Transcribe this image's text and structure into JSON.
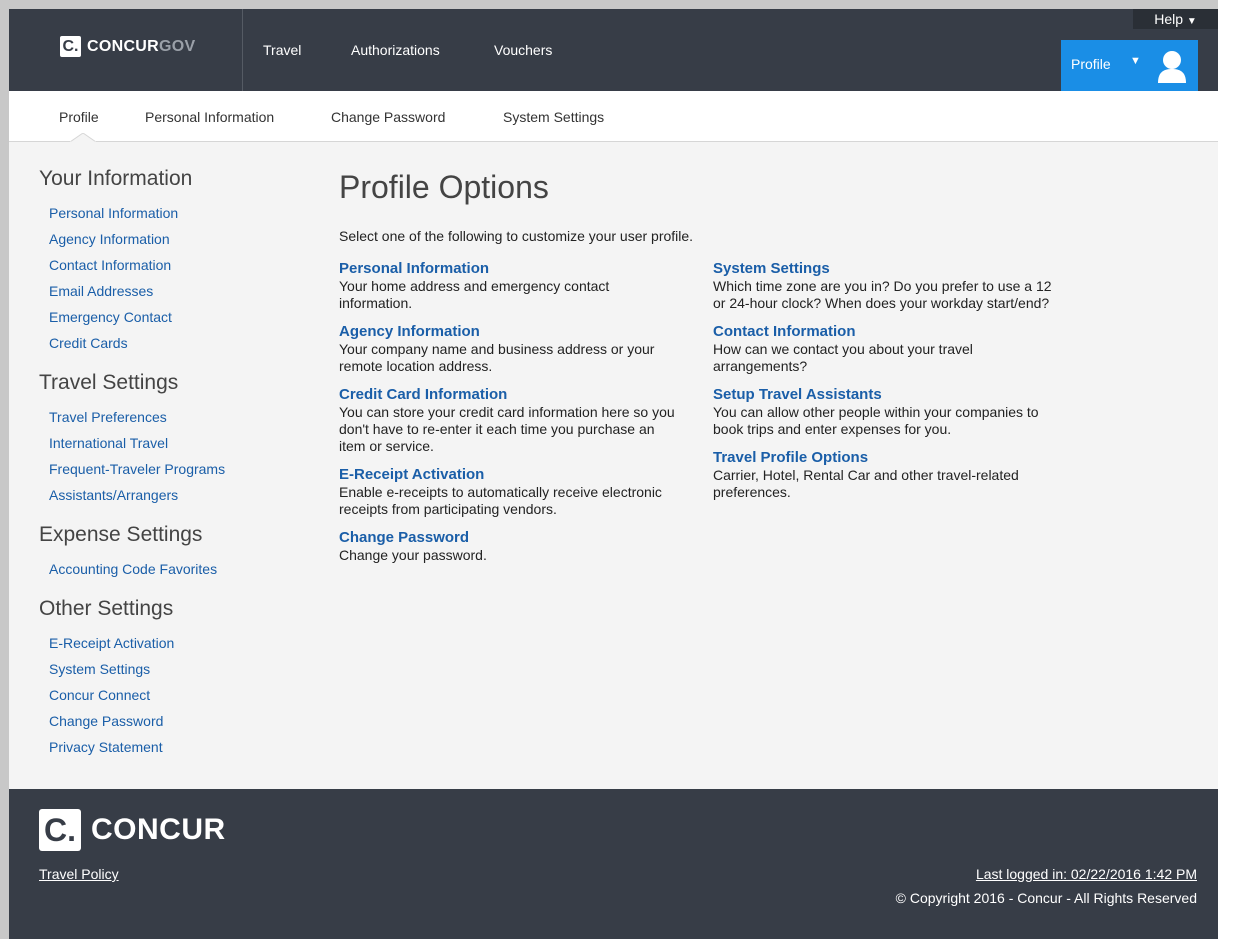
{
  "header": {
    "logo_text": "CONCUR",
    "logo_suffix": "GOV",
    "logo_glyph": "C.",
    "nav": [
      {
        "label": "Travel"
      },
      {
        "label": "Authorizations"
      },
      {
        "label": "Vouchers"
      }
    ],
    "help_label": "Help",
    "profile_label": "Profile",
    "accent_color": "#1a8ee6",
    "bg_color": "#373d47"
  },
  "subnav": {
    "items": [
      {
        "label": "Profile"
      },
      {
        "label": "Personal Information"
      },
      {
        "label": "Change Password"
      },
      {
        "label": "System Settings"
      }
    ]
  },
  "sidebar": {
    "sections": [
      {
        "heading": "Your Information",
        "links": [
          "Personal Information",
          "Agency Information",
          "Contact Information",
          "Email Addresses",
          "Emergency Contact",
          "Credit Cards"
        ]
      },
      {
        "heading": "Travel Settings",
        "links": [
          "Travel Preferences",
          "International Travel",
          "Frequent-Traveler Programs",
          "Assistants/Arrangers"
        ]
      },
      {
        "heading": "Expense Settings",
        "links": [
          "Accounting Code Favorites"
        ]
      },
      {
        "heading": "Other Settings",
        "links": [
          "E-Receipt Activation",
          "System Settings",
          "Concur Connect",
          "Change Password",
          "Privacy Statement"
        ]
      }
    ]
  },
  "main": {
    "title": "Profile Options",
    "intro": "Select one of the following to customize your user profile.",
    "left_options": [
      {
        "title": "Personal Information",
        "desc": "Your home address and emergency contact information."
      },
      {
        "title": "Agency Information",
        "desc": "Your company name and business address or your remote location address."
      },
      {
        "title": "Credit Card Information",
        "desc": "You can store your credit card information here so you don't have to re-enter it each time you purchase an item or service."
      },
      {
        "title": "E-Receipt Activation",
        "desc": "Enable e-receipts to automatically receive electronic receipts from participating vendors."
      },
      {
        "title": "Change Password",
        "desc": "Change your password."
      }
    ],
    "right_options": [
      {
        "title": "System Settings",
        "desc": "Which time zone are you in? Do you prefer to use a 12 or 24-hour clock? When does your workday start/end?"
      },
      {
        "title": "Contact Information",
        "desc": "How can we contact you about your travel arrangements?"
      },
      {
        "title": "Setup Travel Assistants",
        "desc": "You can allow other people within your companies to book trips and enter expenses for you."
      },
      {
        "title": "Travel Profile Options",
        "desc": "Carrier, Hotel, Rental Car and other travel-related preferences."
      }
    ]
  },
  "footer": {
    "logo_text": "CONCUR",
    "logo_glyph": "C.",
    "travel_policy": "Travel Policy",
    "last_logged": "Last logged in: 02/22/2016 1:42 PM",
    "copyright": "© Copyright 2016 - Concur - All Rights Reserved"
  }
}
